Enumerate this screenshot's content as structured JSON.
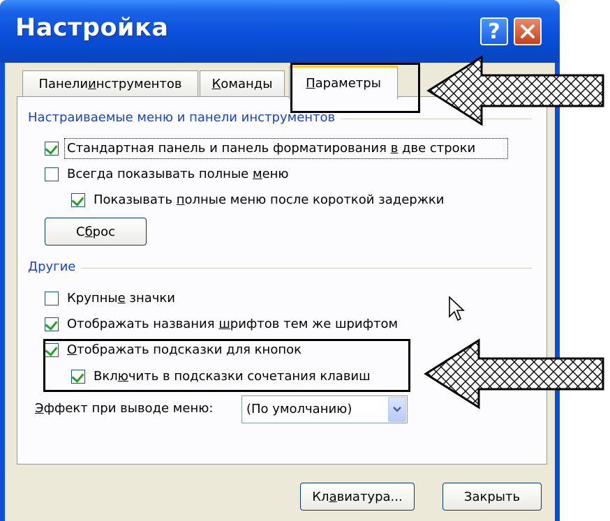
{
  "window": {
    "title": "Настройка"
  },
  "titlebar": {
    "help_glyph": "?",
    "close_icon": "close-icon"
  },
  "tabs": [
    {
      "pre": "Панели ",
      "ul": "и",
      "post": "нструментов",
      "active": false
    },
    {
      "pre": "",
      "ul": "К",
      "post": "оманды",
      "active": false
    },
    {
      "pre": "",
      "ul": "П",
      "post": "араметры",
      "active": true
    }
  ],
  "group1": {
    "title": "Настраиваемые меню и панели инструментов",
    "opt1": {
      "pre": "Стандартная панель и панель форматирования ",
      "ul": "в",
      "post": " две строки",
      "checked": true
    },
    "opt2": {
      "pre": "Всегда показывать полные ",
      "ul": "м",
      "post": "еню",
      "checked": false
    },
    "opt3": {
      "pre": "Показывать ",
      "ul": "п",
      "post": "олные меню после короткой задержки",
      "checked": true
    },
    "reset": {
      "pre": "С",
      "ul": "б",
      "post": "рос"
    }
  },
  "group2": {
    "title": "Другие",
    "opt1": {
      "pre": "Крупны",
      "ul": "е",
      "post": " значки",
      "checked": false
    },
    "opt2": {
      "pre": "Отображать названия ",
      "ul": "ш",
      "post": "рифтов тем же шрифтом",
      "checked": true
    },
    "opt3": {
      "pre": "",
      "ul": "О",
      "post": "тображать подсказки для кнопок",
      "checked": true
    },
    "opt4": {
      "pre": "Вкл",
      "ul": "ю",
      "post": "чить в подсказки сочетания клавиш",
      "checked": true
    },
    "effect": {
      "label_ul": "Э",
      "label_post": "ффект при выводе меню:",
      "value": "(По умолчанию)"
    }
  },
  "footer": {
    "keyboard": {
      "pre": "Кл",
      "ul": "а",
      "post": "виатура..."
    },
    "close_label": "Закрыть"
  },
  "colors": {
    "accent_tab": "#ffc83c",
    "group_title": "#1a42d0",
    "titlebar": "#0a4fdc",
    "check": "#21a121"
  }
}
